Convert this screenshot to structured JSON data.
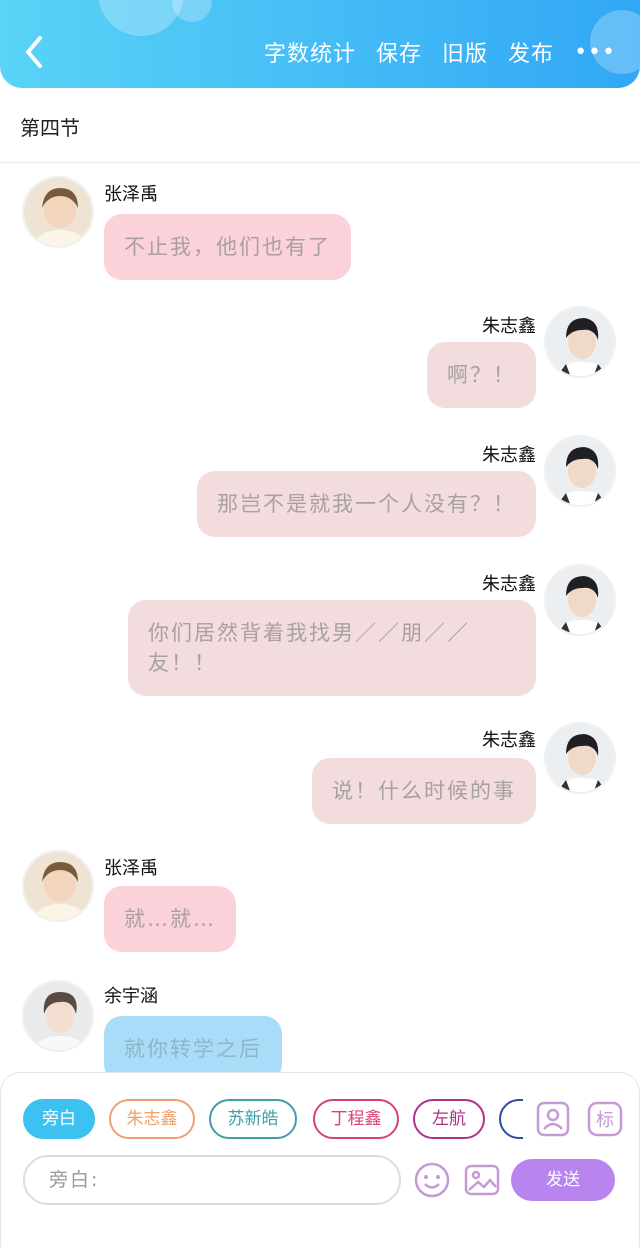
{
  "header": {
    "actions": [
      "字数统计",
      "保存",
      "旧版",
      "发布"
    ],
    "more": "•••"
  },
  "section_title": "第四节",
  "messages": [
    {
      "speaker": "张泽禹",
      "text": "不止我，他们也有了",
      "side": "left",
      "color": "pink"
    },
    {
      "speaker": "朱志鑫",
      "text": "啊？！",
      "side": "right",
      "color": "rose"
    },
    {
      "speaker": "朱志鑫",
      "text": "那岂不是就我一个人没有？！",
      "side": "right",
      "color": "rose"
    },
    {
      "speaker": "朱志鑫",
      "text": "你们居然背着我找男／／朋／／友！！",
      "side": "right",
      "color": "rose"
    },
    {
      "speaker": "朱志鑫",
      "text": "说！什么时候的事",
      "side": "right",
      "color": "rose"
    },
    {
      "speaker": "张泽禹",
      "text": "就…就…",
      "side": "left",
      "color": "pink"
    },
    {
      "speaker": "余宇涵",
      "text": "就你转学之后",
      "side": "left",
      "color": "blue"
    }
  ],
  "panel": {
    "chips": [
      {
        "label": "旁白",
        "color": "#3cc1f0",
        "filled": true
      },
      {
        "label": "朱志鑫",
        "color": "#f0a070",
        "filled": false
      },
      {
        "label": "苏新皓",
        "color": "#3f9ea8",
        "filled": false
      },
      {
        "label": "丁程鑫",
        "color": "#d8407a",
        "filled": false
      },
      {
        "label": "左航",
        "color": "#b0308a",
        "filled": false
      }
    ],
    "input_placeholder": "旁白:",
    "send_label": "发送"
  },
  "colors": {
    "header_start": "#5ad3f7",
    "header_end": "#31a7f5",
    "send": "#b885ee",
    "pink_bubble": "#fbd1da",
    "rose_bubble": "#f2dcdd",
    "blue_bubble": "#a9dcf8"
  }
}
